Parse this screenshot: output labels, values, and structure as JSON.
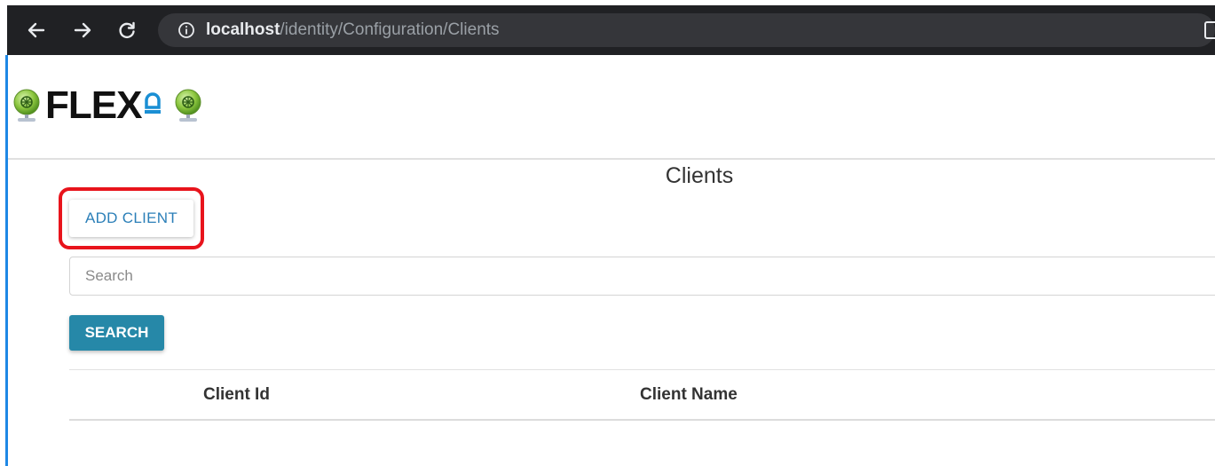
{
  "browser": {
    "url_host": "localhost",
    "url_path": "/identity/Configuration/Clients",
    "back_icon": "arrow-left-icon",
    "forward_icon": "arrow-right-icon",
    "reload_icon": "reload-icon",
    "info_icon": "info-circle-icon"
  },
  "header": {
    "logo_text": "FLEX",
    "logo_icon": "globe-tree-icon"
  },
  "page": {
    "title": "Clients",
    "add_button_label": "ADD CLIENT",
    "search_placeholder": "Search",
    "search_value": "",
    "search_button_label": "SEARCH"
  },
  "table": {
    "columns": [
      "Client Id",
      "Client Name"
    ],
    "rows": []
  },
  "colors": {
    "accent_blue": "#2688a8",
    "link_blue": "#2b7fb8",
    "highlight_red": "#e8141c",
    "browser_dark": "#202124"
  }
}
